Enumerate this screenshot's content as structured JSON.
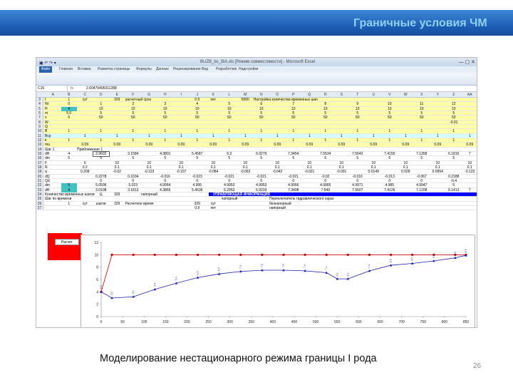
{
  "slide": {
    "title": "Граничные условия ЧМ",
    "caption": "Моделирование нестационарного режима границы I рода",
    "page_number": "26"
  },
  "excel": {
    "window_title": "ВUZB_bs_BiA.xls [Режим совместимости] - Microsoft Excel",
    "tabs": [
      "Файл",
      "Главная",
      "Вставка",
      "Разметка страницы",
      "Формулы",
      "Данные",
      "Рецензирование",
      "Вид",
      "Разработчик",
      "Надстройки"
    ],
    "name_box": "C16",
    "formula_value": "2.60479405311288",
    "columns": [
      "A",
      "B",
      "C",
      "D",
      "E",
      "F",
      "G",
      "H",
      "I",
      "J",
      "K",
      "L",
      "M",
      "N",
      "O",
      "P",
      "Q",
      "R",
      "S",
      "T",
      "U",
      "V",
      "W",
      "X",
      "Y",
      "Z",
      "AA"
    ],
    "rows": [
      {
        "n": "3",
        "cells": [
          "t",
          "1",
          "сут",
          "",
          "329",
          "расчетный срок",
          "",
          "",
          "",
          "0.9",
          "пет",
          "",
          "5000",
          "Настройка количества временных шагов",
          "",
          "",
          "",
          "",
          "",
          "",
          "",
          "",
          "",
          "",
          "",
          "",
          ""
        ]
      },
      {
        "n": "4",
        "cells": [
          "Nt",
          "0",
          "",
          "1",
          "",
          "2",
          "",
          "3",
          "",
          "4",
          "",
          "5",
          "",
          "6",
          "",
          "7",
          "",
          "8",
          "",
          "9",
          "",
          "10",
          "",
          "11",
          "",
          "12",
          ""
        ]
      },
      {
        "n": "5",
        "cells": [
          "H",
          "4",
          "",
          "10",
          "",
          "10",
          "",
          "10",
          "",
          "10",
          "",
          "10",
          "",
          "10",
          "",
          "10",
          "",
          "10",
          "",
          "10",
          "",
          "10",
          "",
          "10",
          "",
          "10",
          ""
        ]
      },
      {
        "n": "6",
        "cells": [
          "m",
          "5.0",
          "",
          "5",
          "",
          "5",
          "",
          "5",
          "",
          "5",
          "",
          "5",
          "",
          "5",
          "",
          "5",
          "",
          "5",
          "",
          "5",
          "",
          "5",
          "",
          "5",
          "",
          "5",
          ""
        ]
      },
      {
        "n": "7",
        "cells": [
          "x",
          "0",
          "",
          "50",
          "",
          "50",
          "",
          "50",
          "",
          "50",
          "",
          "50",
          "",
          "50",
          "",
          "50",
          "",
          "50",
          "",
          "50",
          "",
          "50",
          "",
          "50",
          "",
          "50",
          ""
        ]
      },
      {
        "n": "8",
        "cells": [
          "W",
          "",
          "",
          "",
          "",
          "",
          "",
          "",
          "",
          "",
          "",
          "",
          "",
          "",
          "",
          "",
          "",
          "",
          "",
          "",
          "",
          "",
          "",
          "",
          "",
          "-0.01",
          ""
        ]
      },
      {
        "n": "9",
        "cells": [
          "Q",
          "",
          "",
          "",
          "",
          "",
          "",
          "",
          "",
          "",
          "",
          "",
          "",
          "",
          "",
          "",
          "",
          "",
          "",
          "",
          "",
          "",
          "",
          "",
          "",
          "",
          ""
        ]
      },
      {
        "n": "10",
        "cells": [
          "B",
          "1",
          "",
          "1",
          "",
          "1",
          "",
          "1",
          "",
          "1",
          "",
          "1",
          "",
          "1",
          "",
          "1",
          "",
          "1",
          "",
          "1",
          "",
          "1",
          "",
          "1",
          "",
          "1",
          ""
        ]
      },
      {
        "n": "11",
        "cells": [
          "Bcp",
          "",
          "1",
          "",
          "1",
          "",
          "1",
          "",
          "1",
          "",
          "1",
          "",
          "1",
          "",
          "1",
          "",
          "1",
          "",
          "1",
          "",
          "1",
          "",
          "1",
          "",
          "1",
          "",
          "1"
        ]
      },
      {
        "n": "12",
        "cells": [
          "k",
          "1",
          "",
          "1",
          "",
          "1",
          "",
          "1",
          "",
          "1",
          "",
          "1",
          "",
          "1",
          "",
          "1",
          "",
          "1",
          "",
          "1",
          "",
          "1",
          "",
          "1",
          "",
          "1",
          ""
        ]
      },
      {
        "n": "13",
        "cells": [
          "mu",
          "",
          "0.09",
          "",
          "0.09",
          "",
          "0.09",
          "",
          "0.09",
          "",
          "0.09",
          "",
          "0.09",
          "",
          "0.09",
          "",
          "0.09",
          "",
          "0.09",
          "",
          "0.09",
          "",
          "0.09",
          "",
          "0.09",
          "",
          "0.09"
        ]
      },
      {
        "n": "14",
        "cells": [
          "Шаг 1",
          "",
          "Приближение 1",
          "",
          "",
          "",
          "",
          "",
          "",
          "",
          "",
          "",
          "",
          "",
          "",
          "",
          "",
          "",
          "",
          "",
          "",
          "",
          "",
          "",
          "",
          "",
          ""
        ]
      },
      {
        "n": "15",
        "cells": [
          "dH",
          "4",
          "",
          "2.9602",
          "",
          "3.1584",
          "",
          "4.3801",
          "",
          "5.4587",
          "",
          "6.3",
          "",
          "6.9279",
          "",
          "7.3454",
          "",
          "7.5534",
          "",
          "7.5642",
          "",
          "7.4155",
          "",
          "7.1358",
          "",
          "6.1816",
          "7"
        ]
      },
      {
        "n": "16",
        "cells": [
          "dm",
          "5",
          "",
          "5",
          "",
          "5",
          "",
          "5",
          "",
          "5",
          "",
          "5",
          "",
          "5",
          "",
          "5",
          "",
          "5",
          "",
          "5",
          "",
          "5",
          "",
          "5",
          "",
          "5",
          ""
        ]
      },
      {
        "n": "17",
        "cells": [
          "F",
          "",
          "5",
          "",
          "10",
          "",
          "10",
          "",
          "10",
          "",
          "10",
          "",
          "10",
          "",
          "10",
          "",
          "10",
          "",
          "10",
          "",
          "10",
          "",
          "10",
          "",
          "10",
          "",
          "10"
        ]
      },
      {
        "n": "18",
        "cells": [
          "R",
          "",
          "0.2",
          "",
          "0.1",
          "",
          "0.1",
          "",
          "0.1",
          "",
          "0.1",
          "",
          "0.1",
          "",
          "0.1",
          "",
          "0.1",
          "",
          "0.1",
          "",
          "0.1",
          "",
          "0.1",
          "",
          "0.1",
          "",
          "0.1"
        ]
      },
      {
        "n": "19",
        "cells": [
          "q",
          "",
          "0.208",
          "",
          "-0.02",
          "",
          "-0.123",
          "",
          "-0.107",
          "",
          "-0.084",
          "",
          "-0.063",
          "",
          "-0.042",
          "",
          "-0.021",
          "",
          "-0.001",
          "",
          "0.0149",
          "",
          "0.028",
          "",
          "0.0954",
          "",
          "-0.123"
        ]
      },
      {
        "n": "20",
        "cells": [
          "dQ",
          "",
          "",
          "0.2278",
          "",
          "0.1034",
          "",
          "-0.016",
          "",
          "-0.023",
          "",
          "-0.021",
          "",
          "-0.021",
          "",
          "-0.021",
          "",
          "-0.02",
          "",
          "-0.016",
          "",
          "-0.013",
          "",
          "-0.067",
          "",
          "0.2188",
          ""
        ]
      },
      {
        "n": "21",
        "cells": [
          "Qd",
          "",
          "",
          "0",
          "",
          "0",
          "",
          "0",
          "",
          "0",
          "",
          "0",
          "",
          "0",
          "",
          "0",
          "",
          "0",
          "",
          "0",
          "",
          "0",
          "",
          "0",
          "",
          "-0.4",
          ""
        ]
      },
      {
        "n": "22",
        "cells": [
          "dm",
          "5",
          "",
          "5.0506",
          "",
          "5.023",
          "",
          "4.9964",
          "",
          "4.995",
          "",
          "4.9953",
          "",
          "4.9953",
          "",
          "4.9956",
          "",
          "4.9965",
          "",
          "4.9971",
          "",
          "4.985",
          "",
          "4.9947",
          "",
          "5",
          ""
        ]
      },
      {
        "n": "23",
        "cells": [
          "dH",
          "4",
          "",
          "3.0108",
          "",
          "3.1813",
          "",
          "4.3865",
          "",
          "5.4536",
          "",
          "6.2953",
          "",
          "6.9233",
          "",
          "7.3408",
          "",
          "7.549",
          "",
          "7.5607",
          "",
          "7.4126",
          "",
          "7.1208",
          "",
          "6.1413",
          "7"
        ]
      },
      {
        "n": "24",
        "cells": [
          "Количество временных шагов",
          "",
          "",
          "Ц",
          "329",
          "",
          "напорный",
          "",
          "",
          "",
          "",
          "",
          "",
          "",
          "",
          "",
          "",
          "",
          "",
          "",
          "",
          "",
          "",
          "",
          "",
          "",
          ""
        ]
      },
      {
        "n": "25",
        "cells": [
          "Шаг по времени",
          "",
          "",
          "",
          "",
          "",
          "",
          "",
          "",
          "",
          "",
          "напорный",
          "",
          "",
          "Переключатель гидравлического характера ВГ",
          "",
          "",
          "",
          "",
          "",
          "",
          "",
          "",
          "",
          "",
          "",
          ""
        ]
      },
      {
        "n": "26",
        "cells": [
          "",
          "1",
          "сут",
          "шагов",
          "329",
          "Расчетное время",
          "",
          "",
          "",
          "329",
          "сут",
          "",
          "",
          "",
          "безнапорный",
          "",
          "",
          "",
          "",
          "",
          "",
          "",
          "",
          "",
          "",
          "",
          ""
        ]
      },
      {
        "n": "27",
        "cells": [
          "",
          "",
          "",
          "",
          "",
          "",
          "",
          "",
          "",
          "0.9",
          "пет",
          "",
          "",
          "",
          "напорный",
          "",
          "",
          "",
          "",
          "",
          "",
          "",
          "",
          "",
          "",
          "",
          ""
        ]
      }
    ],
    "banner_text": "УПРАВЛЯЮЩАЯ ИНФОРМАЦИЯ",
    "red_button": "Расчет"
  },
  "chart_data": {
    "type": "line",
    "x_ticks": [
      0,
      50,
      100,
      150,
      200,
      250,
      300,
      350,
      400,
      450,
      500,
      550,
      600,
      650,
      700,
      750,
      800,
      850
    ],
    "y_ticks": [
      0,
      2,
      4,
      6,
      8,
      10,
      12
    ],
    "ylim": [
      0,
      12
    ],
    "xlim": [
      0,
      850
    ],
    "series": [
      {
        "style": "red-circles",
        "values": [
          [
            0,
            4
          ],
          [
            25,
            10
          ],
          [
            75,
            10
          ],
          [
            125,
            10
          ],
          [
            175,
            10
          ],
          [
            225,
            10
          ],
          [
            275,
            10
          ],
          [
            325,
            10
          ],
          [
            375,
            10
          ],
          [
            425,
            10
          ],
          [
            475,
            10
          ],
          [
            525,
            10
          ],
          [
            575,
            10
          ],
          [
            625,
            10
          ],
          [
            675,
            10
          ],
          [
            725,
            10
          ],
          [
            775,
            10
          ],
          [
            825,
            10
          ],
          [
            850,
            10
          ]
        ]
      },
      {
        "style": "blue-triangles",
        "values": [
          [
            0,
            4
          ],
          [
            25,
            3.0
          ],
          [
            75,
            3.2
          ],
          [
            125,
            4.4
          ],
          [
            175,
            5.4
          ],
          [
            225,
            6.3
          ],
          [
            275,
            6.9
          ],
          [
            325,
            7.3
          ],
          [
            375,
            7.5
          ],
          [
            425,
            7.5
          ],
          [
            475,
            7.4
          ],
          [
            525,
            7.1
          ],
          [
            550,
            6.1
          ],
          [
            575,
            6.1
          ],
          [
            625,
            7.4
          ],
          [
            675,
            8.3
          ],
          [
            725,
            8.6
          ],
          [
            775,
            9.0
          ],
          [
            825,
            9.5
          ],
          [
            850,
            9.9
          ]
        ]
      }
    ],
    "point_labels": [
      "4.0",
      "3.0",
      "3.2",
      "4.4",
      "5.4",
      "6.3",
      "6.9",
      "7.3",
      "7.5",
      "7.5",
      "7.4",
      "7.1",
      "6.1",
      "6.1",
      "7.4",
      "8.3",
      "8.6",
      "9.0",
      "9.5",
      "9.9"
    ],
    "colors": {
      "red": "#cc0000",
      "blue": "#1f1fa8"
    }
  }
}
